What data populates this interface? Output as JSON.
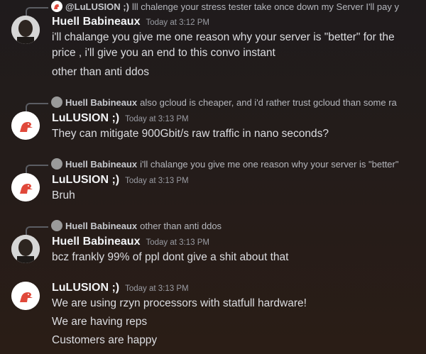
{
  "messages": [
    {
      "reply": {
        "author": "@LuLUSION ;)",
        "text": "lll chalenge your stress tester take once down my Server I'll pay y"
      },
      "author": "Huell Babineaux",
      "timestamp": "Today at 3:12 PM",
      "lines": [
        "i'll chalange you give me one reason why your server is \"better\" for the",
        "price , i'll give you an end to this convo instant",
        "other than anti ddos"
      ]
    },
    {
      "reply": {
        "author": "Huell Babineaux",
        "text": "also gcloud is cheaper, and i'd rather trust gcloud than some ra"
      },
      "author": "LuLUSION ;)",
      "timestamp": "Today at 3:13 PM",
      "lines": [
        "They can mitigate 900Gbit/s raw traffic in nano seconds?"
      ]
    },
    {
      "reply": {
        "author": "Huell Babineaux",
        "text": "i'll chalange you give me one reason why your server is \"better\""
      },
      "author": "LuLUSION ;)",
      "timestamp": "Today at 3:13 PM",
      "lines": [
        "Bruh"
      ]
    },
    {
      "reply": {
        "author": "Huell Babineaux",
        "text": "other than anti ddos"
      },
      "author": "Huell Babineaux",
      "timestamp": "Today at 3:13 PM",
      "lines": [
        "bcz frankly 99% of ppl dont give a shit about that"
      ]
    },
    {
      "author": "LuLUSION ;)",
      "timestamp": "Today at 3:13 PM",
      "lines": [
        "We are using rzyn processors with statfull hardware!",
        "We are having reps",
        "Customers are happy"
      ]
    }
  ],
  "colors": {
    "background": "#241c1a",
    "username": "#f2f3f5",
    "timestamp": "#9a9ca3",
    "text": "#dcdde1"
  },
  "icons": {
    "huell_avatar": "bald-man-avatar",
    "lulusion_avatar": "red-dinosaur-avatar"
  }
}
